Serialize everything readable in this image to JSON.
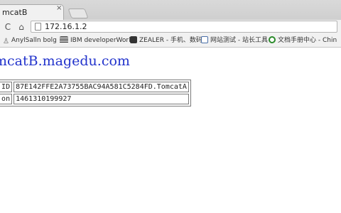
{
  "tab": {
    "title": "mcatB",
    "close": "×"
  },
  "toolbar": {
    "reload_icon": "C",
    "home_icon": "⌂",
    "url": "172.16.1.2"
  },
  "bookmarks": [
    {
      "label": "AnylSalln bolg",
      "icon": "A",
      "color": "#666666"
    },
    {
      "label": "IBM developerWorl",
      "icon": "",
      "color": "#333333"
    },
    {
      "label": "ZEALER - 手机、数码",
      "icon": "Z",
      "color": "#333333"
    },
    {
      "label": "网站测试 - 站长工具",
      "icon": "",
      "color": "#4a6fa8"
    },
    {
      "label": "文档手册中心 - Chin",
      "icon": "",
      "color": "#2a8a2a"
    }
  ],
  "page": {
    "heading": "mcatB.magedu.com",
    "rows": [
      {
        "label": "on ID",
        "value": "87E142FFE2A73755BAC94A581C5284FD.TomcatA"
      },
      {
        "label": "ed on",
        "value": "1461310199927"
      }
    ]
  }
}
